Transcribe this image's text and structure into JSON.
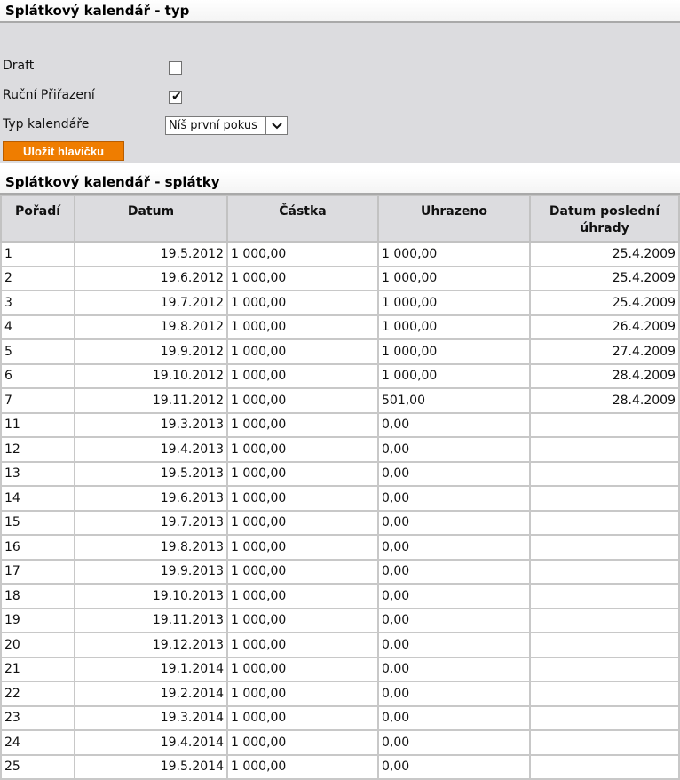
{
  "header": {
    "title": "Splátkový kalendář - typ"
  },
  "form": {
    "draft_label": "Draft",
    "draft_checked": false,
    "manual_label": "Ruční Přiřazení",
    "manual_checked": true,
    "type_label": "Typ kalendáře",
    "type_value": "Níš první pokus",
    "save_label": "Uložit hlavičku"
  },
  "installments": {
    "title": "Splátkový kalendář - splátky",
    "columns": [
      "Pořadí",
      "Datum",
      "Částka",
      "Uhrazeno",
      "Datum poslední úhrady"
    ],
    "rows": [
      [
        "1",
        "19.5.2012",
        "1 000,00",
        "1 000,00",
        "25.4.2009"
      ],
      [
        "2",
        "19.6.2012",
        "1 000,00",
        "1 000,00",
        "25.4.2009"
      ],
      [
        "3",
        "19.7.2012",
        "1 000,00",
        "1 000,00",
        "25.4.2009"
      ],
      [
        "4",
        "19.8.2012",
        "1 000,00",
        "1 000,00",
        "26.4.2009"
      ],
      [
        "5",
        "19.9.2012",
        "1 000,00",
        "1 000,00",
        "27.4.2009"
      ],
      [
        "6",
        "19.10.2012",
        "1 000,00",
        "1 000,00",
        "28.4.2009"
      ],
      [
        "7",
        "19.11.2012",
        "1 000,00",
        "501,00",
        "28.4.2009"
      ],
      [
        "11",
        "19.3.2013",
        "1 000,00",
        "0,00",
        ""
      ],
      [
        "12",
        "19.4.2013",
        "1 000,00",
        "0,00",
        ""
      ],
      [
        "13",
        "19.5.2013",
        "1 000,00",
        "0,00",
        ""
      ],
      [
        "14",
        "19.6.2013",
        "1 000,00",
        "0,00",
        ""
      ],
      [
        "15",
        "19.7.2013",
        "1 000,00",
        "0,00",
        ""
      ],
      [
        "16",
        "19.8.2013",
        "1 000,00",
        "0,00",
        ""
      ],
      [
        "17",
        "19.9.2013",
        "1 000,00",
        "0,00",
        ""
      ],
      [
        "18",
        "19.10.2013",
        "1 000,00",
        "0,00",
        ""
      ],
      [
        "19",
        "19.11.2013",
        "1 000,00",
        "0,00",
        ""
      ],
      [
        "20",
        "19.12.2013",
        "1 000,00",
        "0,00",
        ""
      ],
      [
        "21",
        "19.1.2014",
        "1 000,00",
        "0,00",
        ""
      ],
      [
        "22",
        "19.2.2014",
        "1 000,00",
        "0,00",
        ""
      ],
      [
        "23",
        "19.3.2014",
        "1 000,00",
        "0,00",
        ""
      ],
      [
        "24",
        "19.4.2014",
        "1 000,00",
        "0,00",
        ""
      ],
      [
        "25",
        "19.5.2014",
        "1 000,00",
        "0,00",
        ""
      ]
    ]
  },
  "colors": {
    "panel": "#dcdcdf",
    "button": "#ef7d00"
  }
}
